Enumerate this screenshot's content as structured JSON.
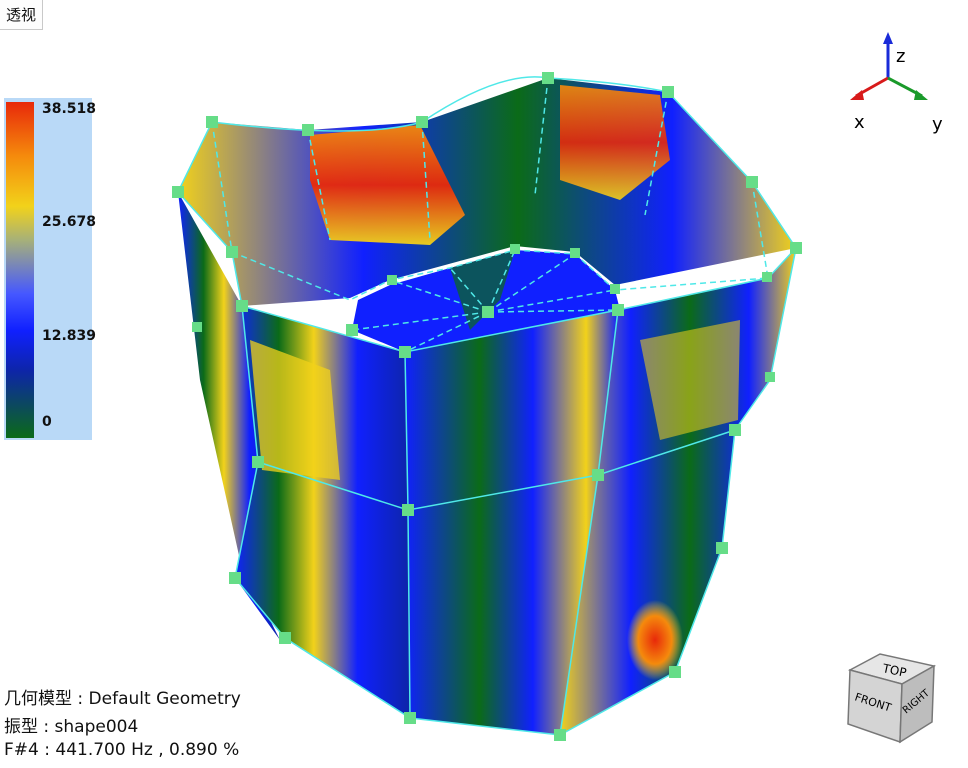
{
  "view_tab": {
    "label": "透视"
  },
  "legend": {
    "ticks": [
      "38.518",
      "25.678",
      "12.839",
      "0"
    ]
  },
  "axes": {
    "x": "x",
    "y": "y",
    "z": "z"
  },
  "viewcube": {
    "top": "TOP",
    "front": "FRONT",
    "right": "RIGHT"
  },
  "info": {
    "geometry_label": "几何模型",
    "geometry_value": "Default Geometry",
    "shape_label": "振型",
    "shape_value": "shape004",
    "mode_label": "F#4",
    "mode_value": "441.700 Hz , 0.890 %"
  },
  "colors": {
    "mesh_line": "#4fe8e8",
    "node": "#66dd88",
    "high": "#e8290a",
    "mid": "#f2d21a",
    "low": "#1020ff",
    "zero": "#0b6b18"
  }
}
